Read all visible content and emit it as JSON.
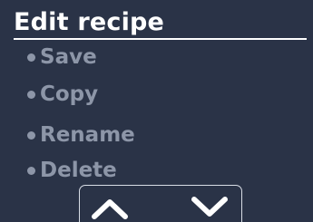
{
  "screen": {
    "title": "Edit recipe"
  },
  "menu": {
    "items": [
      {
        "label": "Save"
      },
      {
        "label": "Copy"
      },
      {
        "label": "Rename"
      },
      {
        "label": "Delete"
      }
    ]
  },
  "navigation": {
    "up_icon": "chevron-up-icon",
    "down_icon": "chevron-down-icon"
  },
  "colors": {
    "background": "#2a3347",
    "title": "#ffffff",
    "menu_text": "#8d96a8",
    "nav_border": "#d8dde6"
  }
}
